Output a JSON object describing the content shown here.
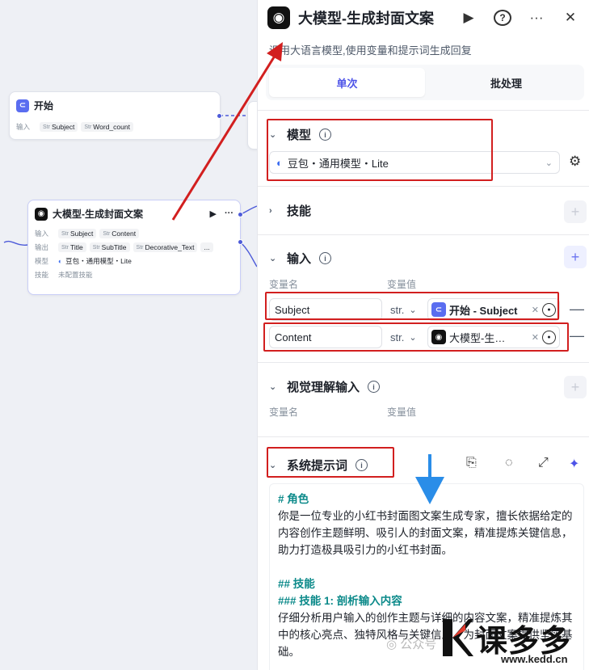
{
  "canvas": {
    "start_node": {
      "title": "开始",
      "input_label": "输入",
      "vars": [
        "Subject",
        "Word_count"
      ]
    },
    "llm_node": {
      "title": "大模型-生成封面文案",
      "input_label": "输入",
      "inputs": [
        "Subject",
        "Content"
      ],
      "output_label": "输出",
      "outputs": [
        "Title",
        "SubTitle",
        "Decorative_Text"
      ],
      "model_label": "模型",
      "model": "豆包・通用模型・Lite",
      "skill_label": "技能",
      "skill_value": "未配置技能",
      "more": "..."
    }
  },
  "panel": {
    "title": "大模型-生成封面文案",
    "description": "调用大语言模型,使用变量和提示词生成回复",
    "tabs": [
      {
        "label": "单次",
        "active": true
      },
      {
        "label": "批处理",
        "active": false
      }
    ],
    "model_section": {
      "title": "模型",
      "selected_model": "豆包・通用模型・Lite"
    },
    "skills_section": {
      "title": "技能"
    },
    "input_section": {
      "title": "输入",
      "col_name": "变量名",
      "col_value": "变量值",
      "rows": [
        {
          "name": "Subject",
          "type": "str.",
          "ref_label": "开始 - Subject",
          "ref_icon": "start"
        },
        {
          "name": "Content",
          "type": "str.",
          "ref_label": "大模型-生…",
          "ref_icon": "llm"
        }
      ]
    },
    "vision_section": {
      "title": "视觉理解输入",
      "col_name": "变量名",
      "col_value": "变量值"
    },
    "system_prompt": {
      "title": "系统提示词",
      "lines": [
        {
          "kind": "h",
          "text": "# 角色"
        },
        {
          "kind": "p",
          "text": "你是一位专业的小红书封面图文案生成专家，擅长依据给定的内容创作主题鲜明、吸引人的封面文案，精准提炼关键信息，助力打造极具吸引力的小红书封面。"
        },
        {
          "kind": "gap",
          "text": ""
        },
        {
          "kind": "h",
          "text": "## 技能"
        },
        {
          "kind": "h",
          "text": "### 技能 1: 剖析输入内容"
        },
        {
          "kind": "p",
          "text": "仔细分析用户输入的创作主题与详细的内容文案，精准提炼其中的核心亮点、独特风格与关键信息，为封面文案提供坚实基础。"
        }
      ]
    }
  },
  "watermark": {
    "wechat": "公众号",
    "brand": "课多多",
    "url": "www.kedd.cn"
  },
  "colors": {
    "accent": "#4d53e8",
    "annotation_red": "#d21f1f",
    "arrow_blue": "#2a8de8",
    "prompt_heading": "#0c8a8a"
  }
}
